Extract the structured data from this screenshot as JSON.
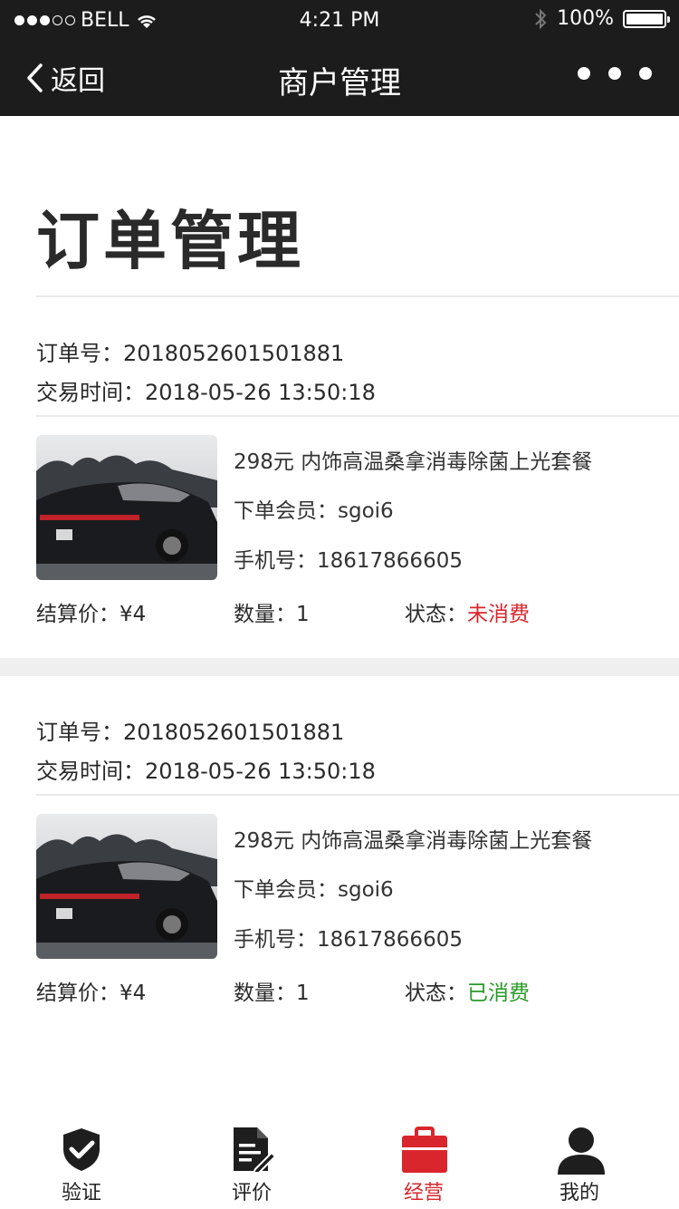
{
  "status_bar": {
    "carrier": "BELL",
    "time": "4:21 PM",
    "battery": "100%"
  },
  "nav": {
    "back_label": "返回",
    "title": "商户管理"
  },
  "page": {
    "title": "订单管理"
  },
  "orders": [
    {
      "order_no": "订单号：2018052601501881",
      "trade_time": "交易时间：2018-05-26 13:50:18",
      "package": "298元 内饰高温桑拿消毒除菌上光套餐",
      "member": "下单会员：sgoi6",
      "phone": "手机号：18617866605",
      "settle": "结算价：¥4",
      "qty": "数量：1",
      "status_label": "状态：",
      "status_value": "未消费",
      "status_color": "#d9262c"
    },
    {
      "order_no": "订单号：2018052601501881",
      "trade_time": "交易时间：2018-05-26 13:50:18",
      "package": "298元 内饰高温桑拿消毒除菌上光套餐",
      "member": "下单会员：sgoi6",
      "phone": "手机号：18617866605",
      "settle": "结算价：¥4",
      "qty": "数量：1",
      "status_label": "状态：",
      "status_value": "已消费",
      "status_color": "#2a9a2a"
    }
  ],
  "tabbar": {
    "tabs": [
      {
        "label": "验证",
        "icon": "shield-check-icon",
        "active": false
      },
      {
        "label": "评价",
        "icon": "document-edit-icon",
        "active": false
      },
      {
        "label": "经营",
        "icon": "briefcase-icon",
        "active": true
      },
      {
        "label": "我的",
        "icon": "user-icon",
        "active": false
      }
    ],
    "active_color": "#d9262c"
  }
}
